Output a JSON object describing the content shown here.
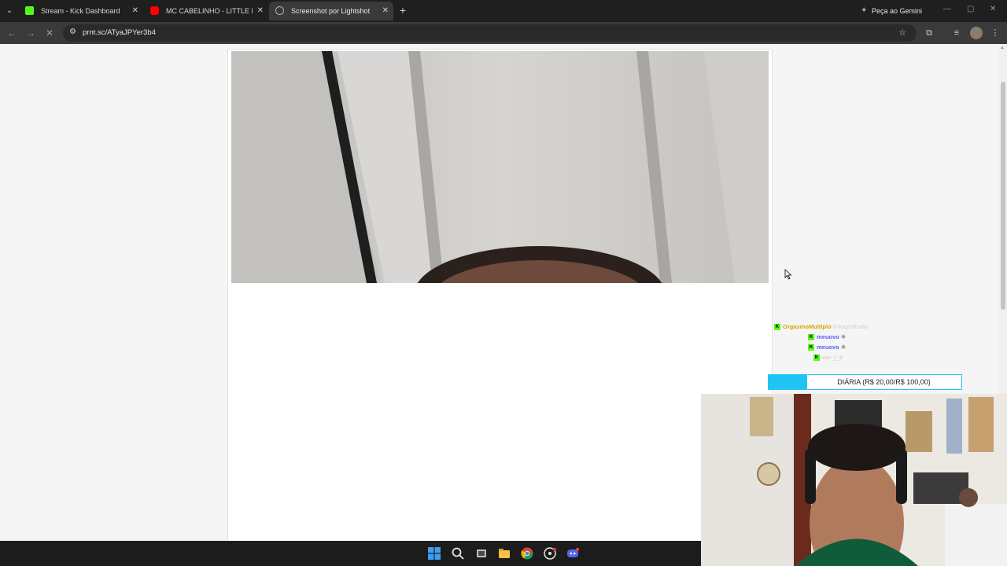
{
  "browser": {
    "tabs": [
      {
        "label": "Stream - Kick Dashboard",
        "favicon": "kick-icon",
        "color": "#53fc18",
        "active": false
      },
      {
        "label": "MC CABELINHO - LITTLE HAIR (",
        "favicon": "youtube-icon",
        "color": "#ff0000",
        "active": false
      },
      {
        "label": "Screenshot por Lightshot",
        "favicon": "lightshot-icon",
        "color": "#b0b0b0",
        "active": true
      }
    ],
    "new_tab_symbol": "+",
    "gemini_label": "Peça ao Gemini",
    "url": "prnt.sc/ATyaJPYer3b4"
  },
  "overlay": {
    "chat": [
      {
        "user": "OrgasmoMultiplo",
        "message": "linkapfolhado",
        "user_color": "#d9a400"
      },
      {
        "user": "meuovo",
        "message": "",
        "user_color": "#5a5cff"
      },
      {
        "user": "meuovo",
        "message": "",
        "user_color": "#5a5cff"
      },
      {
        "user": "xxx_r_b",
        "message": "",
        "user_color": "#c9c9c9"
      }
    ],
    "goal_label": "DIÁRIA (R$ 20,00/R$ 100,00)",
    "goal_progress": 0.2
  },
  "colors": {
    "chrome_dark": "#1f1f1f",
    "toolbar": "#3a3a3a",
    "goal_accent": "#1fc4f3"
  }
}
